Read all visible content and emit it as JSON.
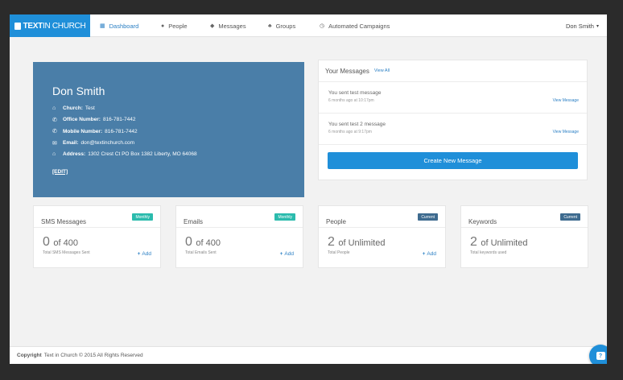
{
  "brand": {
    "text_bold": "TEXT",
    "text_light": "IN CHURCH"
  },
  "nav": {
    "items": [
      {
        "label": "Dashboard",
        "icon": "grid-icon"
      },
      {
        "label": "People",
        "icon": "person-icon"
      },
      {
        "label": "Messages",
        "icon": "comments-icon"
      },
      {
        "label": "Groups",
        "icon": "group-icon"
      },
      {
        "label": "Automated Campaigns",
        "icon": "clock-icon"
      }
    ],
    "user": "Don Smith",
    "active": "Dashboard"
  },
  "profile": {
    "name": "Don Smith",
    "church_label": "Church:",
    "church": "Test",
    "office_label": "Office Number:",
    "office": "816-781-7442",
    "mobile_label": "Mobile Number:",
    "mobile": "816-781-7442",
    "email_label": "Email:",
    "email": "don@textinchurch.com",
    "address_label": "Address:",
    "address": "1302 Crest Ct PO Box 1382 Liberty, MO 64068",
    "edit": "[EDIT]"
  },
  "messages": {
    "title": "Your Messages",
    "view_all": "View All",
    "items": [
      {
        "text": "You sent test message",
        "time": "6 months ago at 10:17pm",
        "link": "View Message"
      },
      {
        "text": "You sent test 2 message",
        "time": "6 months ago at 9:17pm",
        "link": "View Message"
      }
    ],
    "create_button": "Create New Message"
  },
  "cards": [
    {
      "title": "SMS Messages",
      "badge": "Monthly",
      "badge_color": "#2bbbad",
      "count": "0",
      "of": "of 400",
      "sub": "Total SMS Messages Sent",
      "add": "Add"
    },
    {
      "title": "Emails",
      "badge": "Monthly",
      "badge_color": "#2bbbad",
      "count": "0",
      "of": "of 400",
      "sub": "Total Emails Sent",
      "add": "Add"
    },
    {
      "title": "People",
      "badge": "Current",
      "badge_color": "#3e6b8f",
      "count": "2",
      "of": "of Unlimited",
      "sub": "Total People",
      "add": "Add"
    },
    {
      "title": "Keywords",
      "badge": "Current",
      "badge_color": "#3e6b8f",
      "count": "2",
      "of": "of Unlimited",
      "sub": "Total keywords used",
      "add": ""
    }
  ],
  "footer": {
    "label": "Copyright",
    "text": "Text in Church © 2015 All Rights Reserved"
  },
  "colors": {
    "brand": "#1f8fd9",
    "profile_bg": "#4a7ea8",
    "teal_badge": "#2bbbad",
    "navy_badge": "#3e6b8f"
  }
}
